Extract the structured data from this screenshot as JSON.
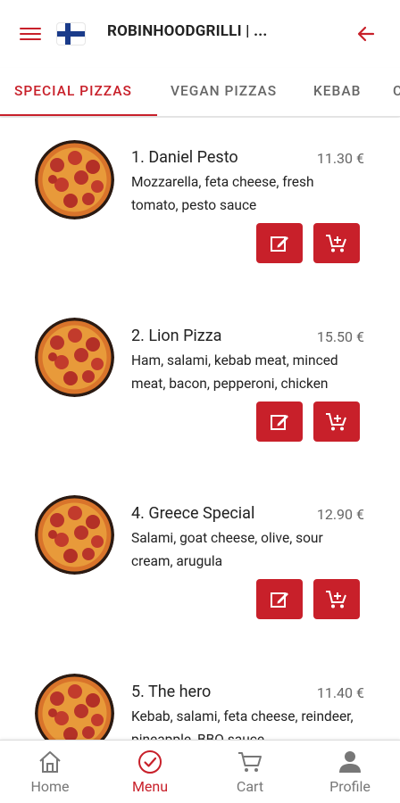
{
  "header": {
    "title": "ROBINHOODGRILLI | ...",
    "menu_icon": "hamburger-menu-icon",
    "flag_icon": "finland-flag-icon",
    "back_icon": "arrow-left-icon"
  },
  "tabs": [
    {
      "label": "SPECIAL PIZZAS",
      "active": true
    },
    {
      "label": "VEGAN PIZZAS",
      "active": false
    },
    {
      "label": "KEBAB",
      "active": false
    },
    {
      "label": "C",
      "active": false
    }
  ],
  "items": [
    {
      "name": "1. Daniel Pesto",
      "price": "11.30 €",
      "description": "Mozzarella, feta cheese, fresh tomato, pesto sauce"
    },
    {
      "name": "2. Lion Pizza",
      "price": "15.50 €",
      "description": "Ham, salami, kebab meat, minced meat, bacon, pepperoni, chicken"
    },
    {
      "name": "4. Greece Special",
      "price": "12.90 €",
      "description": "Salami, goat cheese, olive, sour cream, arugula"
    },
    {
      "name": "5. The hero",
      "price": "11.40 €",
      "description": "Kebab, salami, feta cheese, reindeer, pineapple, BBQ sauce"
    }
  ],
  "bottom_nav": [
    {
      "label": "Home",
      "icon": "home-icon",
      "active": false
    },
    {
      "label": "Menu",
      "icon": "check-circle-icon",
      "active": true
    },
    {
      "label": "Cart",
      "icon": "cart-icon",
      "active": false
    },
    {
      "label": "Profile",
      "icon": "person-icon",
      "active": false
    }
  ],
  "colors": {
    "accent": "#c8202a",
    "text": "#222222",
    "muted": "#666666"
  }
}
